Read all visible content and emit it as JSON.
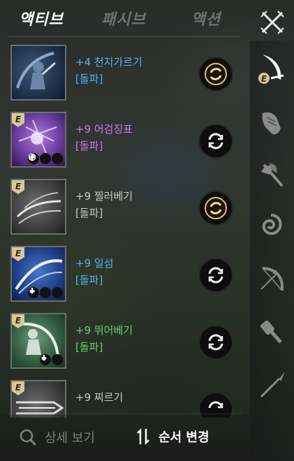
{
  "tabs": [
    "액티브",
    "패시브",
    "액션"
  ],
  "active_tab": 0,
  "skills": [
    {
      "level": "+4 천지가르기",
      "type": "[돌파]",
      "color": "blue",
      "badge": false,
      "mode": "gold"
    },
    {
      "level": "+9 어검징표",
      "type": "[돌파]",
      "color": "purple",
      "badge": true,
      "mode": "white"
    },
    {
      "level": "+9 찔러베기",
      "type": "[돌파]",
      "color": "grey",
      "badge": true,
      "mode": "gold"
    },
    {
      "level": "+9 일섬",
      "type": "[돌파]",
      "color": "navy",
      "badge": true,
      "mode": "white"
    },
    {
      "level": "+9 뛰어베기",
      "type": "[돌파]",
      "color": "green",
      "badge": true,
      "mode": "white"
    },
    {
      "level": "+9 찌르기",
      "type": "",
      "color": "grey",
      "badge": true,
      "mode": "white"
    }
  ],
  "badge_letter": "E",
  "bottom": {
    "detail_label": "상세 보기",
    "order_label": "순서 변경"
  },
  "sidebar_icons": [
    "sword-icon",
    "gauntlet-icon",
    "axe-icon",
    "swirl-icon",
    "bow-icon",
    "hammer-icon",
    "spear-icon"
  ],
  "colors": {
    "blue": "#5bb0f0",
    "purple": "#c27bf0",
    "grey": "#c9c9c9",
    "green": "#6ad068",
    "gold": "#d8b45a"
  }
}
